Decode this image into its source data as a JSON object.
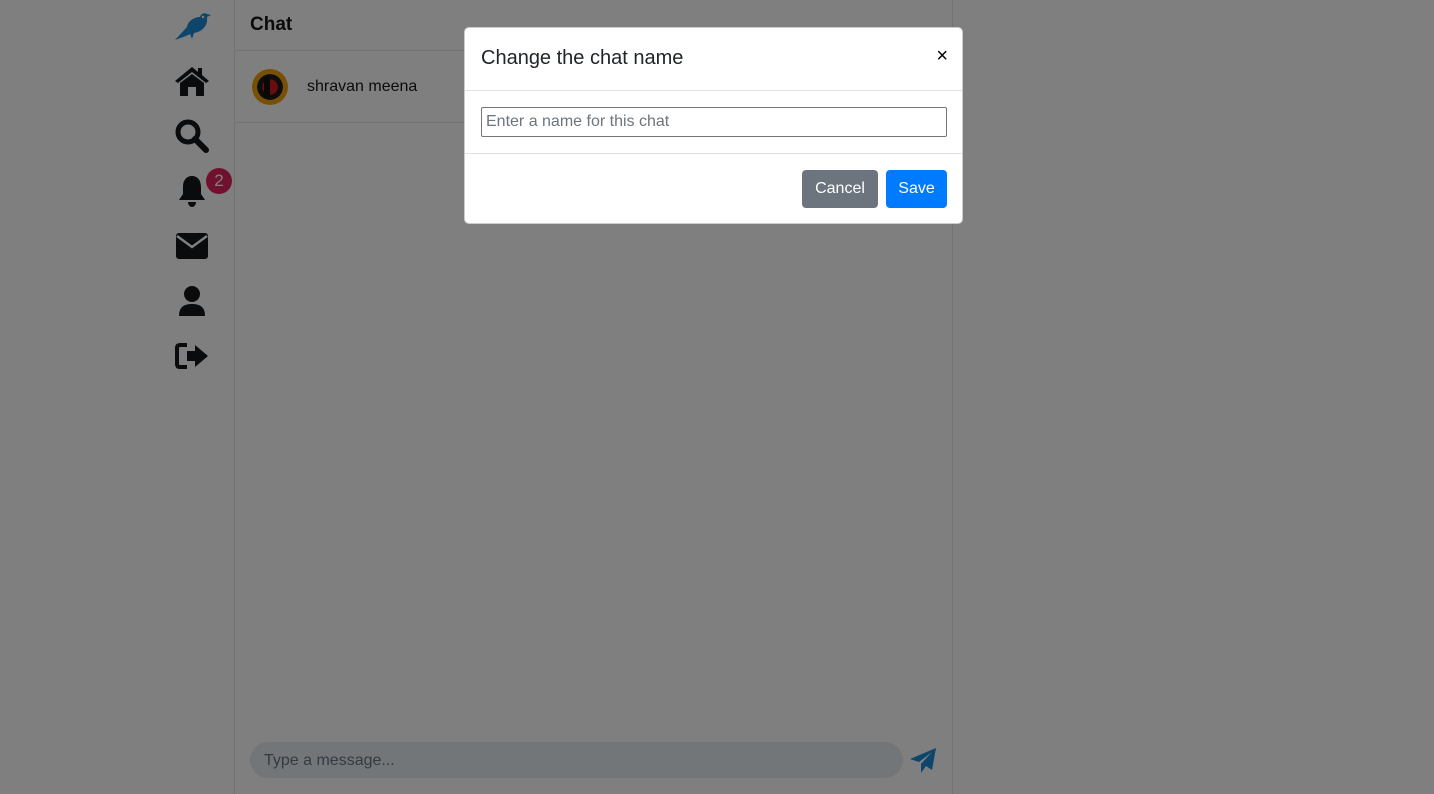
{
  "nav": {
    "items": [
      {
        "icon": "bird-logo-icon",
        "color": "#1da1f2"
      },
      {
        "icon": "home-icon"
      },
      {
        "icon": "search-icon"
      },
      {
        "icon": "bell-icon",
        "badge": "2"
      },
      {
        "icon": "envelope-icon"
      },
      {
        "icon": "user-icon"
      },
      {
        "icon": "sign-out-icon"
      }
    ]
  },
  "chat": {
    "title": "Chat",
    "participants": [
      {
        "name": "shravan meena"
      }
    ],
    "composer": {
      "placeholder": "Type a message..."
    }
  },
  "modal": {
    "title": "Change the chat name",
    "close_label": "×",
    "input_placeholder": "Enter a name for this chat",
    "input_value": "",
    "cancel_label": "Cancel",
    "save_label": "Save"
  },
  "colors": {
    "accent": "#1da1f2",
    "save": "#007bff",
    "cancel": "#6c757d",
    "badge": "#e0245e"
  }
}
